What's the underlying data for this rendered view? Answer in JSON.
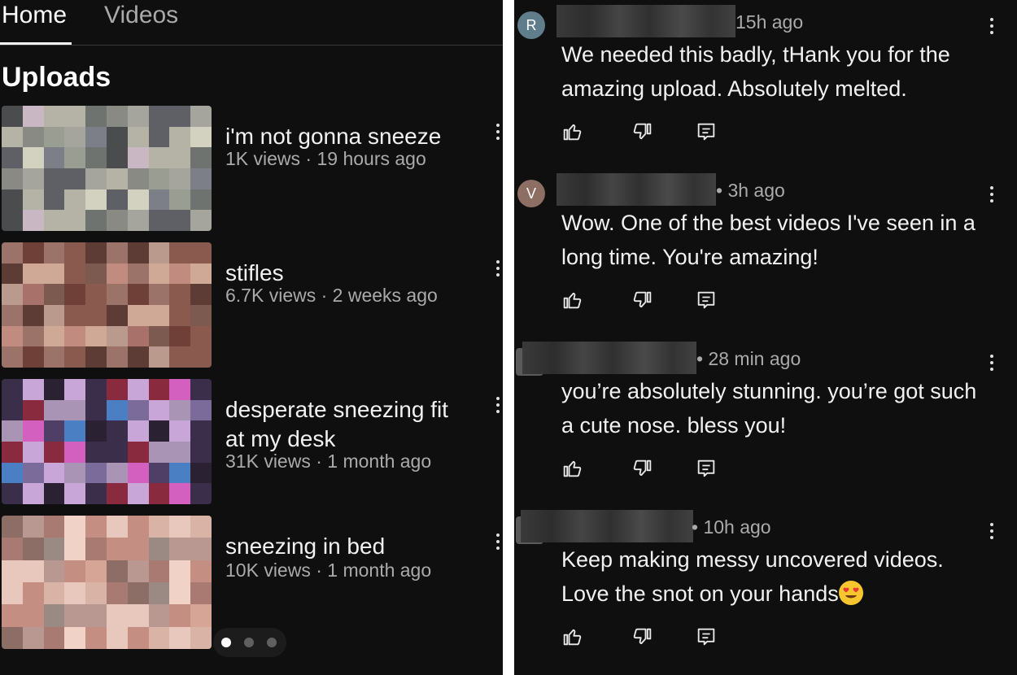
{
  "left": {
    "tabs": [
      {
        "label": "Home",
        "active": true
      },
      {
        "label": "Videos",
        "active": false
      }
    ],
    "section_title": "Uploads",
    "videos": [
      {
        "title": "i'm not gonna sneeze",
        "meta": "1K views · 19 hours ago"
      },
      {
        "title": "stifles",
        "meta": "6.7K views · 2 weeks ago"
      },
      {
        "title": "desperate sneezing fit at my desk",
        "meta": "31K views · 1 month ago"
      },
      {
        "title": "sneezing in bed",
        "meta": "10K views · 1 month ago"
      }
    ],
    "pager": {
      "pages": 3,
      "active_index": 0
    }
  },
  "comments": [
    {
      "avatar_letter": "R",
      "avatar_color": "#607d8b",
      "time": "15h ago",
      "text": "We needed this badly, tHank you for the amazing upload. Absolutely melted.",
      "emoji": false
    },
    {
      "avatar_letter": "V",
      "avatar_color": "#8d6e63",
      "time": "• 3h ago",
      "text": "Wow.  One of the best videos I've seen in a long time.  You're amazing!",
      "emoji": false
    },
    {
      "avatar_letter": "",
      "avatar_color": "#5a5a5a",
      "time": "• 28 min ago",
      "text": "you’re absolutely stunning. you’re got such a cute nose. bless you!",
      "emoji": false
    },
    {
      "avatar_letter": "",
      "avatar_color": "#5a5a5a",
      "time": "• 10h ago",
      "text": "Keep making messy uncovered videos. Love the snot on your hands",
      "emoji": true,
      "emoji_name": "heart-eyes-emoji"
    }
  ],
  "icons": {
    "like": "thumbs-up-icon",
    "dislike": "thumbs-down-icon",
    "reply": "reply-comment-icon",
    "more": "more-vertical-icon"
  },
  "colors": {
    "background": "#0f0f0f",
    "text_primary": "#f1f1f1",
    "text_secondary": "#aaaaaa"
  }
}
